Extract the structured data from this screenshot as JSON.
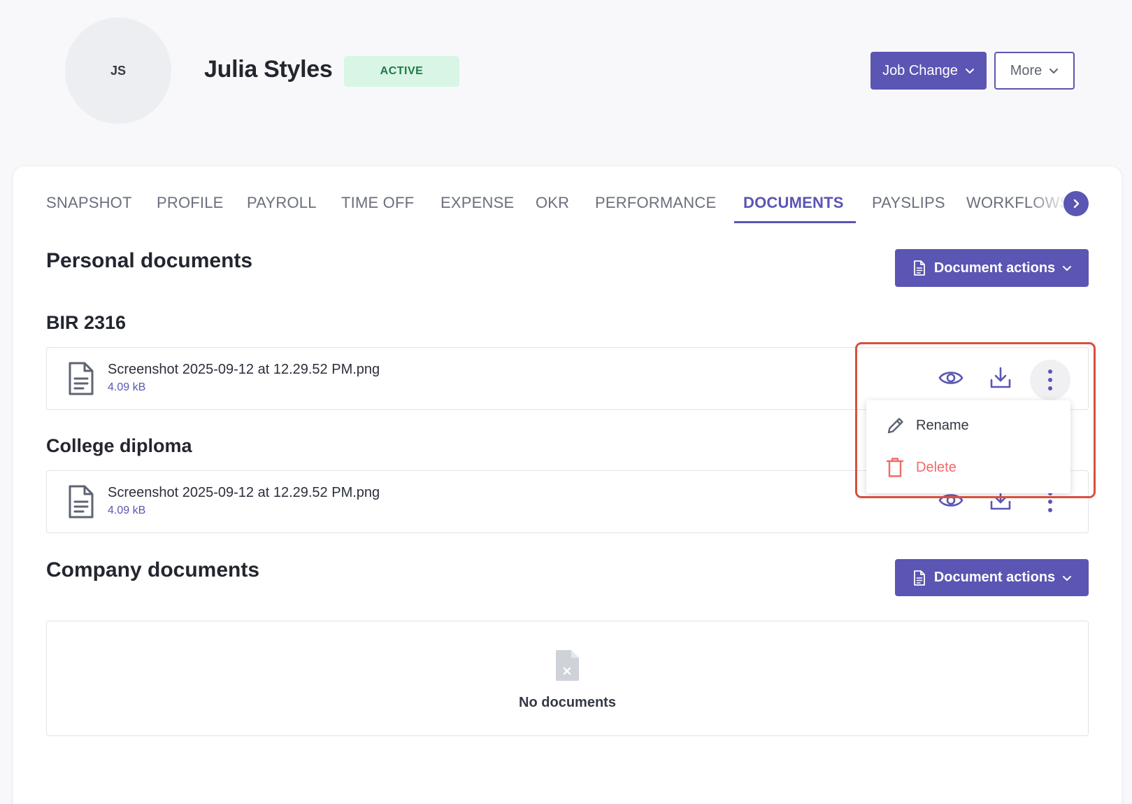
{
  "employee": {
    "initials": "JS",
    "name": "Julia Styles",
    "status": "ACTIVE"
  },
  "header_actions": {
    "job_change_label": "Job Change",
    "more_label": "More"
  },
  "tabs": [
    {
      "label": "SNAPSHOT"
    },
    {
      "label": "PROFILE"
    },
    {
      "label": "PAYROLL"
    },
    {
      "label": "TIME OFF"
    },
    {
      "label": "EXPENSE"
    },
    {
      "label": "OKR"
    },
    {
      "label": "PERFORMANCE"
    },
    {
      "label": "DOCUMENTS",
      "active": true
    },
    {
      "label": "PAYSLIPS"
    },
    {
      "label": "WORKFLOWS"
    }
  ],
  "personal": {
    "title": "Personal documents",
    "actions_label": "Document actions",
    "groups": [
      {
        "title": "BIR 2316",
        "file": "Screenshot 2025-09-12 at 12.29.52 PM.png",
        "size": "4.09 kB"
      },
      {
        "title": "College diploma",
        "file": "Screenshot 2025-09-12 at 12.29.52 PM.png",
        "size": "4.09 kB"
      }
    ]
  },
  "company": {
    "title": "Company documents",
    "actions_label": "Document actions",
    "empty_text": "No documents"
  },
  "row_menu": {
    "rename_label": "Rename",
    "delete_label": "Delete"
  },
  "colors": {
    "accent": "#5b55b4",
    "badge_bg": "#d8f5e6",
    "badge_text": "#1f7a45",
    "danger": "#f06b6b",
    "highlight": "#d9503f"
  }
}
